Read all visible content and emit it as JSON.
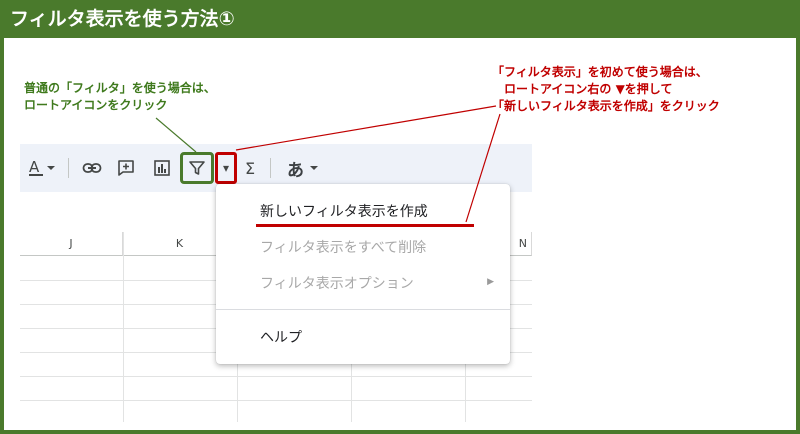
{
  "title": "フィルタ表示を使う方法①",
  "annotations": {
    "green_lines": [
      "普通の「フィルタ」を使う場合は、",
      "ロートアイコンをクリック"
    ],
    "red_lines": [
      "「フィルタ表示」を初めて使う場合は、",
      "ロートアイコン右の ▼を押して",
      "「新しいフィルタ表示を作成」をクリック"
    ]
  },
  "toolbar": {
    "text_color_glyph": "A",
    "sigma_glyph": "Σ",
    "input_tools_glyph": "あ",
    "dropdown_glyph": "▾"
  },
  "columns": [
    "J",
    "K",
    "N"
  ],
  "menu": {
    "items": [
      {
        "label": "新しいフィルタ表示を作成",
        "enabled": true
      },
      {
        "label": "フィルタ表示をすべて削除",
        "enabled": false
      },
      {
        "label": "フィルタ表示オプション",
        "enabled": false,
        "submenu_glyph": "▶"
      },
      {
        "label": "ヘルプ",
        "enabled": true
      }
    ]
  },
  "colors": {
    "frame_green": "#4a7a2c",
    "annotation_green": "#3f7a1d",
    "annotation_red": "#c00000",
    "toolbar_bg": "#eef2f9"
  }
}
